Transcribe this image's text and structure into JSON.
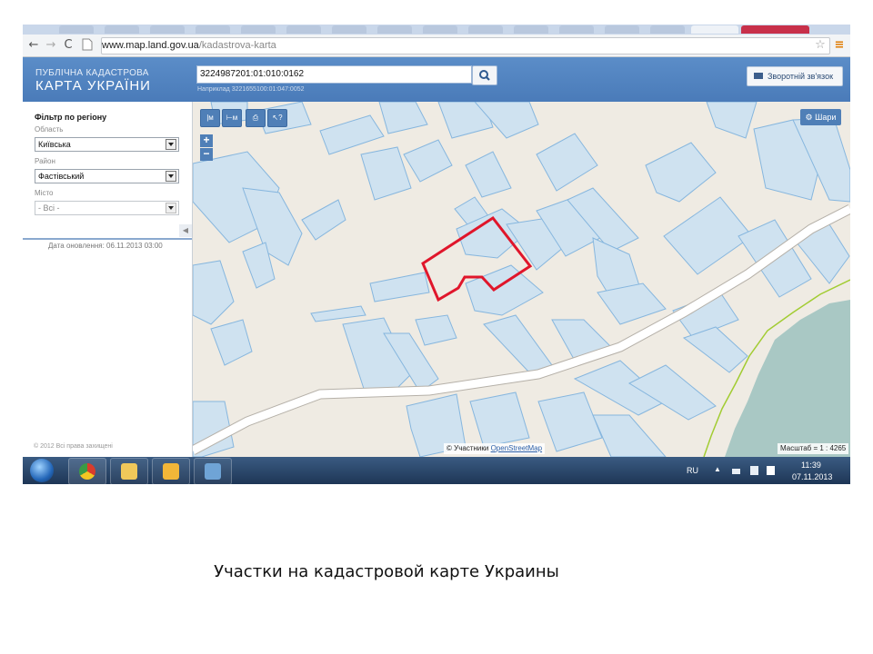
{
  "browser": {
    "url_host": "www.map.land.gov.ua",
    "url_path": "/kadastrova-karta"
  },
  "header": {
    "brand_line1": "ПУБЛІЧНА КАДАСТРОВА",
    "brand_line2": "КАРТА УКРАЇНИ",
    "search_value": "3224987201:01:010:0162",
    "search_hint": "Наприклад 3221655100:01:047:0052",
    "feedback_label": "Зворотній зв'язок"
  },
  "filter": {
    "title": "Фільтр по регіону",
    "region_label": "Область",
    "region_value": "Київська",
    "district_label": "Район",
    "district_value": "Фастівський",
    "city_label": "Місто",
    "city_value": "- Всі -",
    "updated": "Дата оновлення: 06.11.2013 03:00",
    "copyright": "© 2012 Всі права захищені"
  },
  "map": {
    "layers_label": "Шари",
    "attribution_prefix": "© Участники",
    "attribution_link": "OpenStreetMap",
    "scale": "Масштаб = 1 : 4265",
    "zoom_in": "+",
    "zoom_out": "−",
    "colors": {
      "background": "#efebe3",
      "parcel_fill": "#cfe2f0",
      "parcel_stroke": "#86b6de",
      "selected_parcel": "#e0162b",
      "road": "#ffffff",
      "water": "#a9c8c4",
      "boundary_line": "#a2cc32"
    }
  },
  "taskbar": {
    "language": "RU",
    "time": "11:39",
    "date": "07.11.2013"
  },
  "caption": "Участки на кадастровой карте Украины"
}
